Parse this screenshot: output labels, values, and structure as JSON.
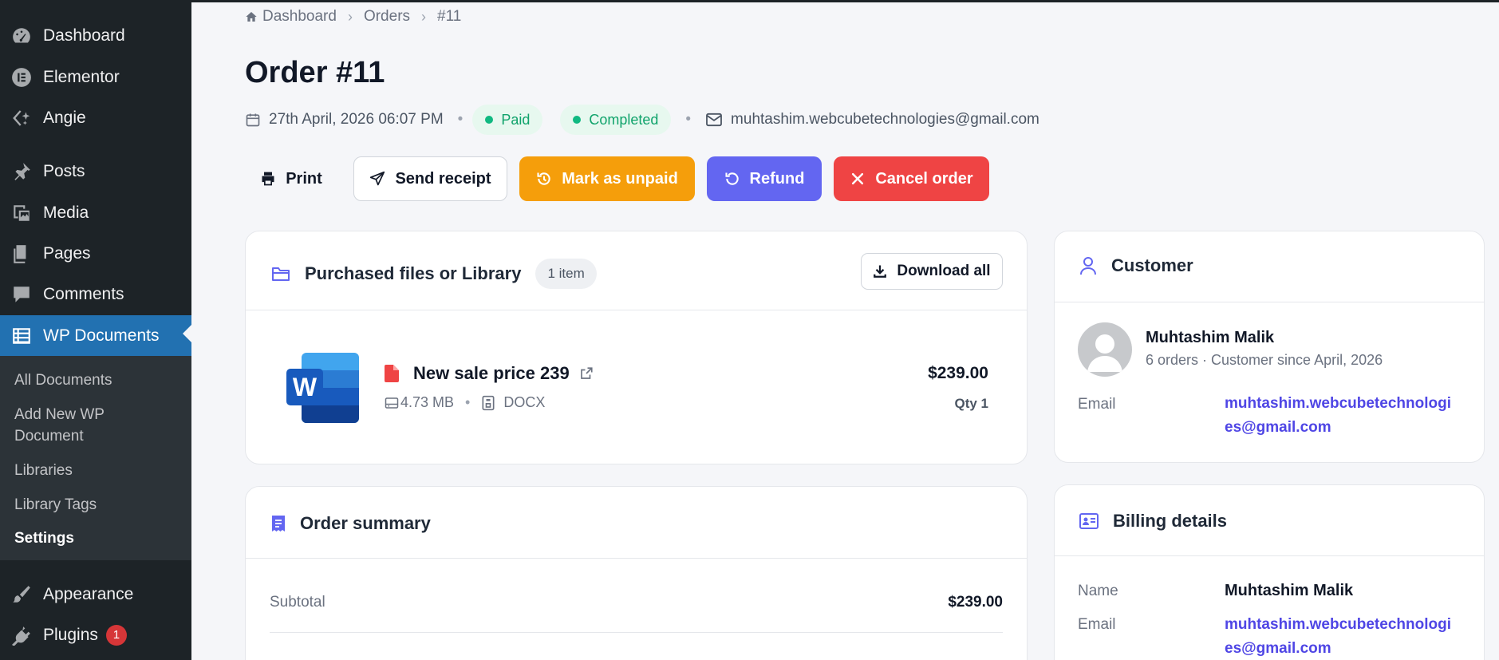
{
  "sidebar": {
    "items": [
      {
        "label": "Dashboard",
        "icon": "dashboard-icon"
      },
      {
        "label": "Elementor",
        "icon": "elementor-icon"
      },
      {
        "label": "Angie",
        "icon": "angie-icon"
      },
      {
        "label": "Posts",
        "icon": "pin-icon"
      },
      {
        "label": "Media",
        "icon": "media-icon"
      },
      {
        "label": "Pages",
        "icon": "pages-icon"
      },
      {
        "label": "Comments",
        "icon": "comment-icon"
      },
      {
        "label": "WP Documents",
        "icon": "list-icon"
      },
      {
        "label": "Appearance",
        "icon": "brush-icon"
      },
      {
        "label": "Plugins",
        "icon": "plug-icon",
        "badge": "1"
      }
    ],
    "submenu": [
      "All Documents",
      "Add New WP",
      "Document",
      "Libraries",
      "Library Tags",
      "Settings"
    ]
  },
  "breadcrumb": {
    "home": "Dashboard",
    "orders": "Orders",
    "current": "#11"
  },
  "order": {
    "title": "Order #11",
    "date": "27th April, 2026 06:07 PM",
    "payment_status": "Paid",
    "order_status": "Completed",
    "email": "muhtashim.webcubetechnologies@gmail.com"
  },
  "actions": {
    "print": "Print",
    "send_receipt": "Send receipt",
    "mark_unpaid": "Mark as unpaid",
    "refund": "Refund",
    "cancel": "Cancel order"
  },
  "files_card": {
    "title": "Purchased files or Library",
    "count_badge": "1 item",
    "download_all": "Download all",
    "file": {
      "name": "New sale price 239",
      "size": "4.73 MB",
      "type": "DOCX",
      "price": "$239.00",
      "qty": "Qty 1"
    }
  },
  "customer_card": {
    "title": "Customer",
    "name": "Muhtashim Malik",
    "sub": "6 orders · Customer since April, 2026",
    "email_label": "Email",
    "email_line1": "muhtashim.webcubetechnologi",
    "email_line2": "es@gmail.com"
  },
  "summary_card": {
    "title": "Order summary",
    "subtotal_label": "Subtotal",
    "subtotal_value": "$239.00"
  },
  "billing_card": {
    "title": "Billing details",
    "name_label": "Name",
    "name_value": "Muhtashim Malik",
    "email_label": "Email",
    "email_line1": "muhtashim.webcubetechnologi",
    "email_line2": "es@gmail.com"
  },
  "colors": {
    "sidebar_bg": "#1d2327",
    "active_menu": "#2271b1",
    "paid_green": "#10a36b",
    "unpaid_orange": "#f59e0b",
    "refund_indigo": "#6366f1",
    "cancel_red": "#ef4444",
    "link_indigo": "#4f46e5"
  }
}
